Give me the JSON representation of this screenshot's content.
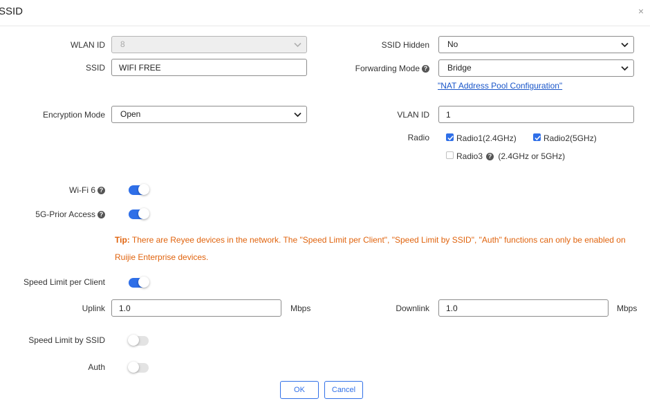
{
  "dialog": {
    "title": "SSID",
    "close_glyph": "×"
  },
  "form": {
    "wlan_id": {
      "label": "WLAN ID",
      "value": "8",
      "disabled": true
    },
    "ssid": {
      "label": "SSID",
      "value": "WIFI FREE"
    },
    "ssid_hidden": {
      "label": "SSID Hidden",
      "value": "No"
    },
    "forwarding_mode": {
      "label": "Forwarding Mode",
      "value": "Bridge",
      "help_glyph": "?"
    },
    "nat_link": "\"NAT Address Pool Configuration\"",
    "encryption_mode": {
      "label": "Encryption Mode",
      "value": "Open"
    },
    "vlan_id": {
      "label": "VLAN ID",
      "value": "1"
    },
    "radio": {
      "label": "Radio",
      "radio1": {
        "label": "Radio1(2.4GHz)",
        "checked": true
      },
      "radio2": {
        "label": "Radio2(5GHz)",
        "checked": true
      },
      "radio3": {
        "label": "Radio3",
        "suffix": "(2.4GHz or 5GHz)",
        "checked": false,
        "help_glyph": "?"
      }
    },
    "wifi6": {
      "label": "Wi-Fi 6",
      "enabled": true,
      "help_glyph": "?"
    },
    "prior_5g": {
      "label": "5G-Prior Access",
      "enabled": true,
      "help_glyph": "?"
    },
    "tip": {
      "prefix": "Tip:",
      "text": "There are Reyee devices in the network. The \"Speed Limit per Client\", \"Speed Limit by SSID\", \"Auth\" functions can only be enabled on Ruijie Enterprise devices."
    },
    "speed_limit_client": {
      "label": "Speed Limit per Client",
      "enabled": true
    },
    "uplink": {
      "label": "Uplink",
      "value": "1.0",
      "unit": "Mbps"
    },
    "downlink": {
      "label": "Downlink",
      "value": "1.0",
      "unit": "Mbps"
    },
    "speed_limit_ssid": {
      "label": "Speed Limit by SSID",
      "enabled": false
    },
    "auth": {
      "label": "Auth",
      "enabled": false
    }
  },
  "buttons": {
    "ok": "OK",
    "cancel": "Cancel"
  },
  "colors": {
    "accent": "#2f6fe8",
    "tip": "#e0630d",
    "link": "#1a56c9",
    "toggle_off": "#e3e3e3"
  }
}
